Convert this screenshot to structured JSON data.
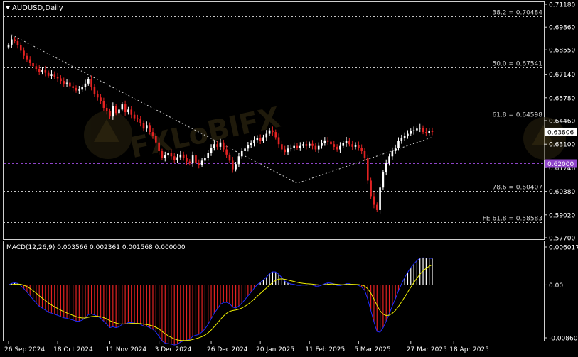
{
  "chart_data": [
    {
      "type": "candlestick",
      "title": "AUDUSD,Daily",
      "y_range": [
        0.577,
        0.7118
      ],
      "y_ticks": [
        "0.71180",
        "0.69860",
        "0.68550",
        "0.67140",
        "0.65780",
        "0.64460",
        "0.63100",
        "0.61746",
        "0.60380",
        "0.59020",
        "0.57700"
      ],
      "current_price": "0.63806",
      "level_line": "0.62000",
      "fib_levels": [
        {
          "label": "38.2 = 0.70484",
          "value": 0.70484
        },
        {
          "label": "50.0 = 0.67541",
          "value": 0.67541
        },
        {
          "label": "61.8 = 0.64598",
          "value": 0.64598
        },
        {
          "label": "78.6 = 0.60407",
          "value": 0.60407
        },
        {
          "label": "FE 61.8 = 0.58583",
          "value": 0.58583
        }
      ],
      "trendline": [
        {
          "bar": 1,
          "price": 0.6942
        },
        {
          "bar": 94,
          "price": 0.6085
        },
        {
          "bar": 138,
          "price": 0.635
        }
      ],
      "closes": [
        0.6885,
        0.6915,
        0.6905,
        0.6882,
        0.685,
        0.682,
        0.68,
        0.6778,
        0.676,
        0.6745,
        0.6728,
        0.674,
        0.6722,
        0.6705,
        0.6715,
        0.67,
        0.669,
        0.6675,
        0.666,
        0.6665,
        0.6645,
        0.6635,
        0.662,
        0.6625,
        0.664,
        0.666,
        0.6685,
        0.664,
        0.66,
        0.658,
        0.656,
        0.652,
        0.65,
        0.647,
        0.653,
        0.649,
        0.651,
        0.654,
        0.6495,
        0.651,
        0.648,
        0.646,
        0.6455,
        0.643,
        0.64,
        0.642,
        0.638,
        0.636,
        0.632,
        0.627,
        0.623,
        0.6245,
        0.626,
        0.624,
        0.622,
        0.6235,
        0.625,
        0.623,
        0.621,
        0.62,
        0.6245,
        0.62,
        0.619,
        0.6215,
        0.623,
        0.626,
        0.629,
        0.631,
        0.6295,
        0.632,
        0.628,
        0.625,
        0.6215,
        0.6165,
        0.6195,
        0.624,
        0.627,
        0.6285,
        0.6305,
        0.6315,
        0.6335,
        0.6345,
        0.633,
        0.635,
        0.637,
        0.639,
        0.638,
        0.635,
        0.631,
        0.628,
        0.6265,
        0.6285,
        0.629,
        0.63,
        0.629,
        0.63,
        0.631,
        0.63,
        0.6312,
        0.63,
        0.628,
        0.63,
        0.6318,
        0.6332,
        0.6325,
        0.631,
        0.6295,
        0.628,
        0.63,
        0.6315,
        0.633,
        0.631,
        0.6295,
        0.6305,
        0.629,
        0.627,
        0.623,
        0.61,
        0.601,
        0.596,
        0.593,
        0.606,
        0.615,
        0.62,
        0.624,
        0.627,
        0.629,
        0.633,
        0.6345,
        0.636,
        0.637,
        0.6385,
        0.639,
        0.64,
        0.6405,
        0.638,
        0.6375,
        0.6385,
        0.63806
      ],
      "first_open": 0.687
    },
    {
      "type": "macd",
      "title": "MACD(12,26,9) 0.003566 0.002361 0.001568 0.000000",
      "y_range": [
        -0.0087,
        0.0063
      ],
      "y_ticks": [
        "0.006017",
        "0.00",
        "-0.008609"
      ]
    }
  ],
  "x_axis": {
    "tick_labels": [
      "26 Sep 2024",
      "18 Oct 2024",
      "11 Nov 2024",
      "3 Dec 2024",
      "26 Dec 2024",
      "20 Jan 2025",
      "11 Feb 2025",
      "5 Mar 2025",
      "27 Mar 2025",
      "18 Apr 2025"
    ],
    "tick_bars": [
      0,
      16,
      33,
      49,
      66,
      82,
      98,
      114,
      131,
      145
    ]
  },
  "watermark_text": "FXLoBIFX",
  "colors": {
    "background": "#000000",
    "bull": "#FFFFFF",
    "bear": "#E32222",
    "grid_dash": "#C8C8C8",
    "level_line": "#8E44C9",
    "level_label_bg": "#8E44C9",
    "price_label_bg": "#FFFFFF",
    "macd_line": "#1E2BFF",
    "signal_line": "#F0F000",
    "hist_pos": "#FFFFFF",
    "hist_neg": "#E32222",
    "watermark": "#5A4A1A"
  }
}
